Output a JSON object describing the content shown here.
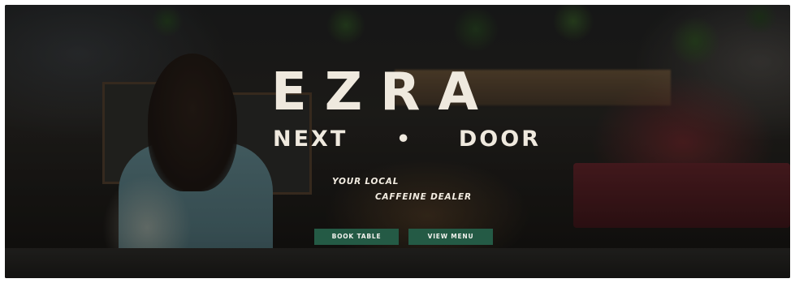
{
  "hero": {
    "brand": "EZRA",
    "sub_left": "NEXT",
    "sub_separator": "•",
    "sub_right": "DOOR",
    "tagline_line1": "YOUR LOCAL",
    "tagline_line2": "CAFFEINE DEALER"
  },
  "actions": {
    "book_table": "BOOK TABLE",
    "view_menu": "VIEW MENU"
  },
  "colors": {
    "button_bg": "#245a45",
    "text_light": "#efe9de"
  }
}
